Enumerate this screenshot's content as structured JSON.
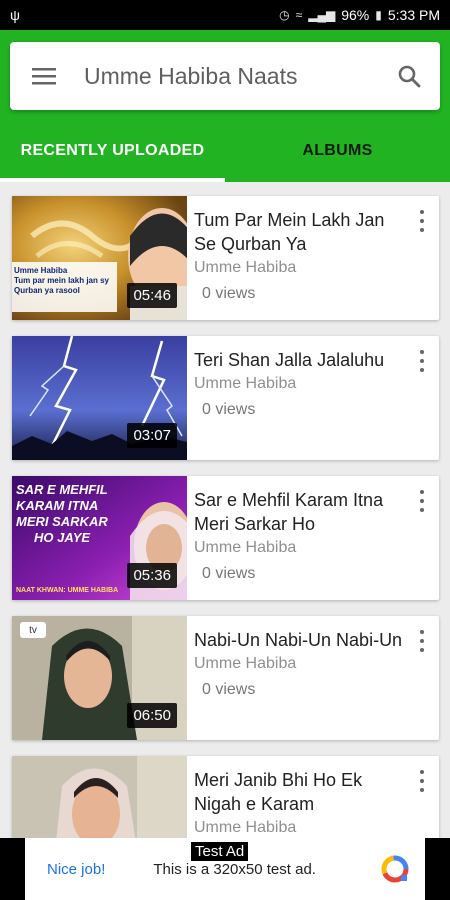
{
  "status_bar": {
    "battery": "96%",
    "time": "5:33 PM"
  },
  "header": {
    "title": "Umme Habiba Naats",
    "accent_color": "#22b322",
    "tabs": [
      {
        "label": "RECENTLY UPLOADED",
        "active": true
      },
      {
        "label": "ALBUMS",
        "active": false
      }
    ]
  },
  "videos": [
    {
      "title": "Tum Par Mein Lakh Jan Se Qurban Ya",
      "channel": "Umme Habiba",
      "views": "0 views",
      "duration": "05:46"
    },
    {
      "title": "Teri Shan Jalla Jalaluhu",
      "channel": "Umme Habiba",
      "views": "0 views",
      "duration": "03:07"
    },
    {
      "title": "Sar e Mehfil Karam Itna Meri Sarkar Ho",
      "channel": "Umme Habiba",
      "views": "0 views",
      "duration": "05:36"
    },
    {
      "title": "Nabi-Un Nabi-Un Nabi-Un",
      "channel": "Umme Habiba",
      "views": "0 views",
      "duration": "06:50"
    },
    {
      "title": "Meri Janib Bhi Ho Ek Nigah e Karam",
      "channel": "Umme Habiba",
      "views": "",
      "duration": ""
    }
  ],
  "thumb_text": {
    "t1_lines": [
      "Umme Habiba",
      "Tum par mein lakh jan sy",
      "Qurban ya rasool"
    ],
    "t3_lines": [
      "SAR E MEHFIL",
      "KARAM ITNA",
      "MERI SARKAR",
      "HO JAYE"
    ],
    "t3_footer": "NAAT KHWAN: UMME HABIBA",
    "t4_logo": "tv"
  },
  "ad": {
    "label": "Test Ad",
    "nice": "Nice job!",
    "text": "This is a 320x50 test ad."
  }
}
